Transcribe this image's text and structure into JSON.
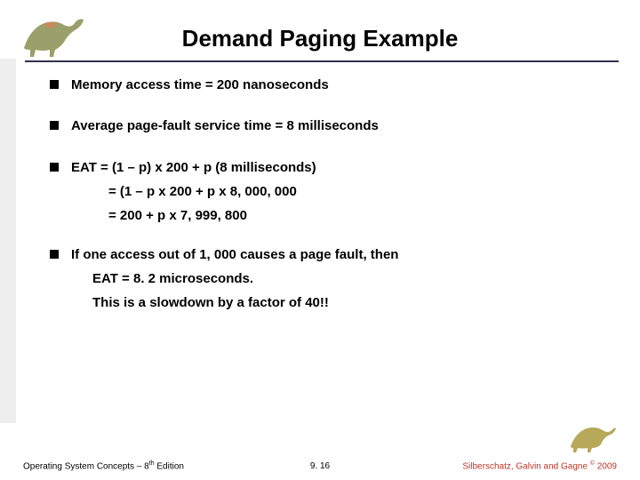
{
  "title": "Demand Paging Example",
  "bullets": {
    "b1": "Memory access time = 200 nanoseconds",
    "b2": "Average page-fault service time = 8 milliseconds",
    "b3": "EAT = (1 – p) x 200 + p (8 milliseconds)",
    "b3s1": "= (1 – p  x 200 + p x 8, 000, 000",
    "b3s2": "= 200 + p x 7, 999, 800",
    "b4": "If one access out of 1, 000 causes a page fault, then",
    "b4s1": "EAT = 8. 2 microseconds.",
    "b4s2": "This is a slowdown by a factor of 40!!"
  },
  "footer": {
    "left_a": "Operating System Concepts – 8",
    "left_sup": "th",
    "left_b": " Edition",
    "center": "9. 16",
    "right_a": "Silberschatz, Galvin and Gagne ",
    "right_sup": "©",
    "right_b": " 2009"
  },
  "icons": {
    "dino_tl": "dinosaur-icon",
    "dino_br": "dinosaur-icon"
  }
}
